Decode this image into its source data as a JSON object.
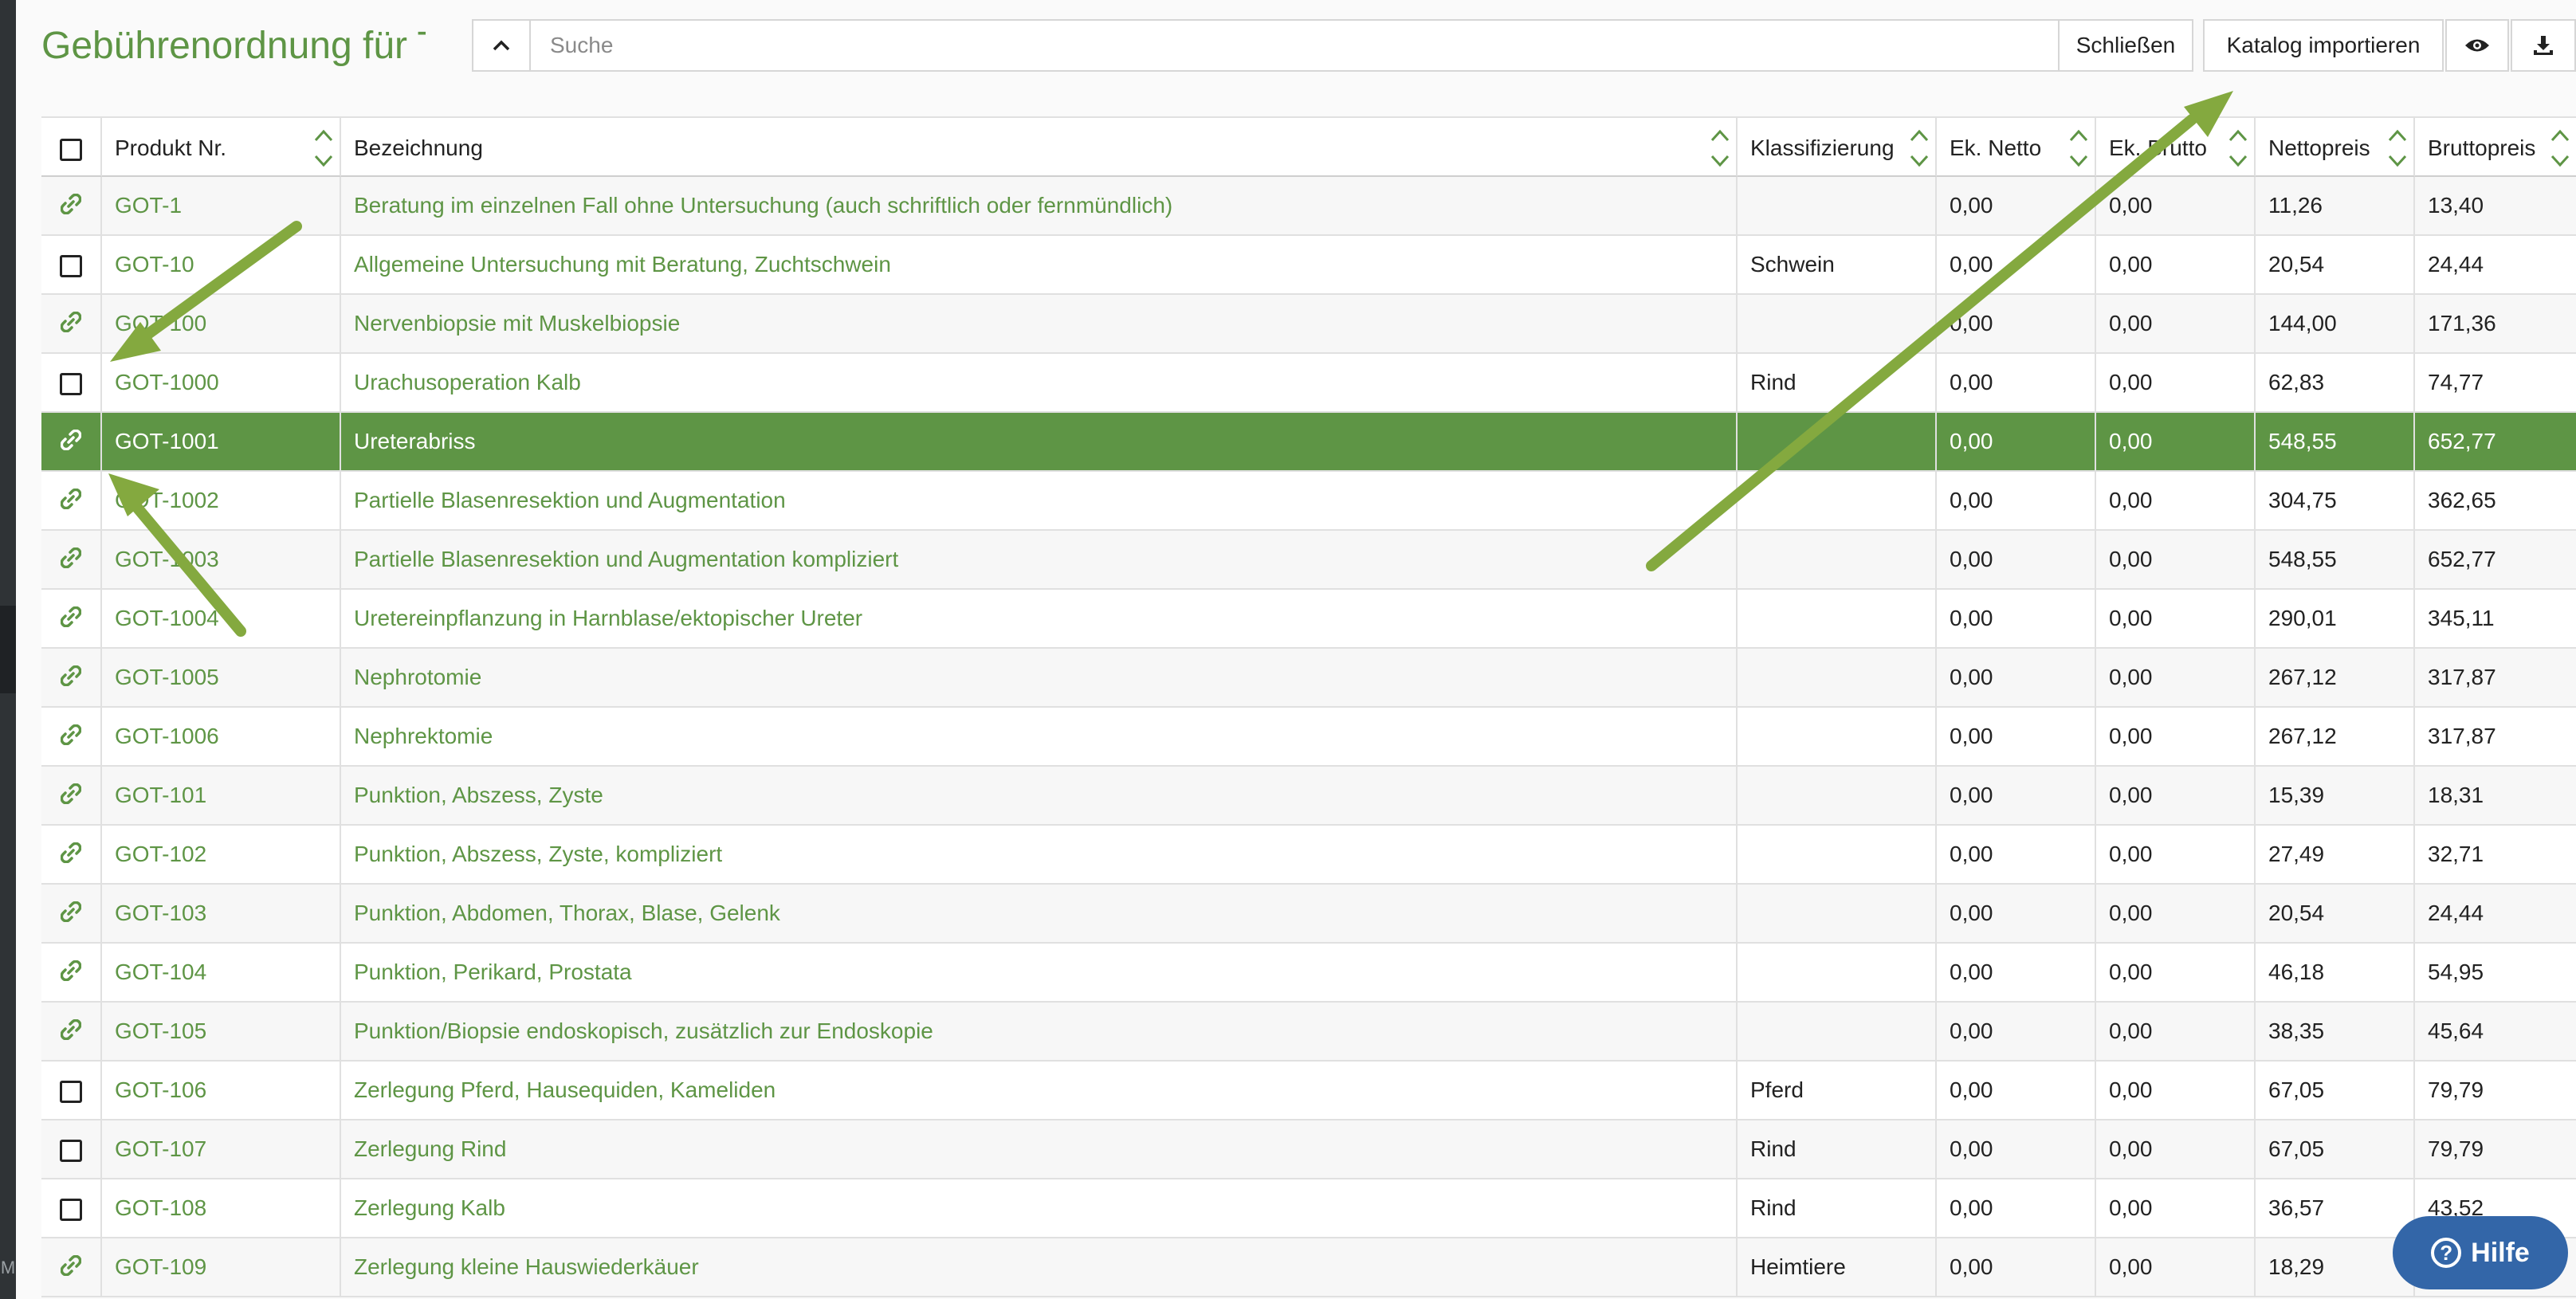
{
  "title": "Gebührenordnung für Tiere",
  "search": {
    "placeholder": "Suche",
    "value": ""
  },
  "buttons": {
    "close": "Schließen",
    "import": "Katalog importieren",
    "help": "Hilfe"
  },
  "columns": [
    "Produkt Nr.",
    "Bezeichnung",
    "Klassifizierung",
    "Ek. Netto",
    "Ek. Brutto",
    "Nettopreis",
    "Bruttopreis"
  ],
  "rows": [
    {
      "type": "link",
      "nr": "GOT-1",
      "bez": "Beratung im einzelnen Fall ohne Untersuchung (auch schriftlich oder fernmündlich)",
      "kl": "",
      "ekn": "0,00",
      "ekb": "0,00",
      "np": "11,26",
      "bp": "13,40"
    },
    {
      "type": "check",
      "nr": "GOT-10",
      "bez": "Allgemeine Untersuchung mit Beratung, Zuchtschwein",
      "kl": "Schwein",
      "ekn": "0,00",
      "ekb": "0,00",
      "np": "20,54",
      "bp": "24,44"
    },
    {
      "type": "link",
      "nr": "GOT-100",
      "bez": "Nervenbiopsie mit Muskelbiopsie",
      "kl": "",
      "ekn": "0,00",
      "ekb": "0,00",
      "np": "144,00",
      "bp": "171,36"
    },
    {
      "type": "check",
      "nr": "GOT-1000",
      "bez": "Urachusoperation Kalb",
      "kl": "Rind",
      "ekn": "0,00",
      "ekb": "0,00",
      "np": "62,83",
      "bp": "74,77"
    },
    {
      "type": "link",
      "nr": "GOT-1001",
      "bez": "Ureterabriss",
      "kl": "",
      "ekn": "0,00",
      "ekb": "0,00",
      "np": "548,55",
      "bp": "652,77",
      "selected": true
    },
    {
      "type": "link",
      "nr": "GOT-1002",
      "bez": "Partielle Blasenresektion und Augmentation",
      "kl": "",
      "ekn": "0,00",
      "ekb": "0,00",
      "np": "304,75",
      "bp": "362,65"
    },
    {
      "type": "link",
      "nr": "GOT-1003",
      "bez": "Partielle Blasenresektion und Augmentation kompliziert",
      "kl": "",
      "ekn": "0,00",
      "ekb": "0,00",
      "np": "548,55",
      "bp": "652,77"
    },
    {
      "type": "link",
      "nr": "GOT-1004",
      "bez": "Uretereinpflanzung in Harnblase/ektopischer Ureter",
      "kl": "",
      "ekn": "0,00",
      "ekb": "0,00",
      "np": "290,01",
      "bp": "345,11"
    },
    {
      "type": "link",
      "nr": "GOT-1005",
      "bez": "Nephrotomie",
      "kl": "",
      "ekn": "0,00",
      "ekb": "0,00",
      "np": "267,12",
      "bp": "317,87"
    },
    {
      "type": "link",
      "nr": "GOT-1006",
      "bez": "Nephrektomie",
      "kl": "",
      "ekn": "0,00",
      "ekb": "0,00",
      "np": "267,12",
      "bp": "317,87"
    },
    {
      "type": "link",
      "nr": "GOT-101",
      "bez": "Punktion, Abszess, Zyste",
      "kl": "",
      "ekn": "0,00",
      "ekb": "0,00",
      "np": "15,39",
      "bp": "18,31"
    },
    {
      "type": "link",
      "nr": "GOT-102",
      "bez": "Punktion, Abszess, Zyste, kompliziert",
      "kl": "",
      "ekn": "0,00",
      "ekb": "0,00",
      "np": "27,49",
      "bp": "32,71"
    },
    {
      "type": "link",
      "nr": "GOT-103",
      "bez": "Punktion, Abdomen, Thorax, Blase, Gelenk",
      "kl": "",
      "ekn": "0,00",
      "ekb": "0,00",
      "np": "20,54",
      "bp": "24,44"
    },
    {
      "type": "link",
      "nr": "GOT-104",
      "bez": "Punktion, Perikard, Prostata",
      "kl": "",
      "ekn": "0,00",
      "ekb": "0,00",
      "np": "46,18",
      "bp": "54,95"
    },
    {
      "type": "link",
      "nr": "GOT-105",
      "bez": "Punktion/Biopsie endoskopisch, zusätzlich zur Endoskopie",
      "kl": "",
      "ekn": "0,00",
      "ekb": "0,00",
      "np": "38,35",
      "bp": "45,64"
    },
    {
      "type": "check",
      "nr": "GOT-106",
      "bez": "Zerlegung Pferd, Hausequiden, Kameliden",
      "kl": "Pferd",
      "ekn": "0,00",
      "ekb": "0,00",
      "np": "67,05",
      "bp": "79,79"
    },
    {
      "type": "check",
      "nr": "GOT-107",
      "bez": "Zerlegung Rind",
      "kl": "Rind",
      "ekn": "0,00",
      "ekb": "0,00",
      "np": "67,05",
      "bp": "79,79"
    },
    {
      "type": "check",
      "nr": "GOT-108",
      "bez": "Zerlegung Kalb",
      "kl": "Rind",
      "ekn": "0,00",
      "ekb": "0,00",
      "np": "36,57",
      "bp": "43,52"
    },
    {
      "type": "link",
      "nr": "GOT-109",
      "bez": "Zerlegung kleine Hauswiederkäuer",
      "kl": "Heimtiere",
      "ekn": "0,00",
      "ekb": "0,00",
      "np": "18,29",
      "bp": ""
    }
  ],
  "icons": [
    "chevron-up-icon",
    "caret-down-icon",
    "search-icon",
    "eye-icon",
    "download-icon",
    "link-icon",
    "sort-icon",
    "question-icon"
  ],
  "colors": {
    "accent": "#5e9545",
    "help": "#3366a8",
    "arrow": "#84a93f"
  }
}
